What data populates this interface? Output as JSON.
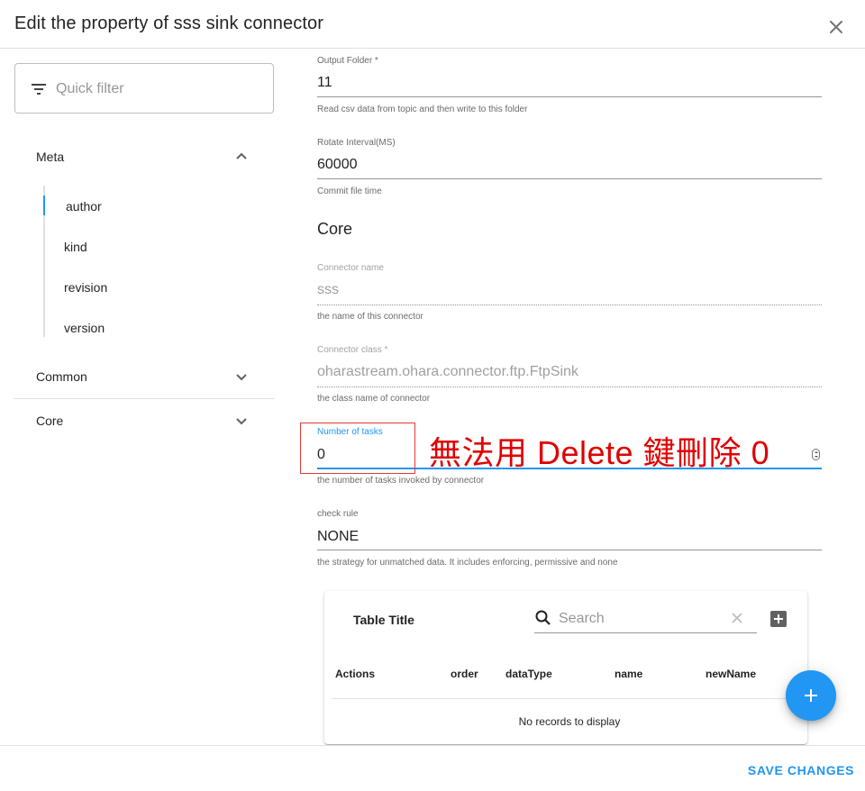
{
  "dialog": {
    "title": "Edit the property of sss sink connector",
    "close_icon": "close-icon"
  },
  "sidebar": {
    "filter_placeholder": "Quick filter",
    "filter_icon": "filter-list-icon",
    "sections": [
      {
        "label": "Meta",
        "expanded": true,
        "icon": "chevron-up-icon"
      },
      {
        "label": "Common",
        "expanded": false,
        "icon": "chevron-down-icon"
      },
      {
        "label": "Core",
        "expanded": false,
        "icon": "chevron-down-icon"
      }
    ],
    "meta_items": [
      {
        "label": "author",
        "active": true
      },
      {
        "label": "kind"
      },
      {
        "label": "revision"
      },
      {
        "label": "version"
      }
    ],
    "accent_color": "#2196f3"
  },
  "form": {
    "output_folder": {
      "label": "Output Folder *",
      "value": "11",
      "help": "Read csv data from topic and then write to this folder"
    },
    "rotate_interval": {
      "label": "Rotate Interval(MS)",
      "value": "60000",
      "help": "Commit file time"
    },
    "core_heading": "Core",
    "connector_name": {
      "label": "Connector name",
      "value": "sss",
      "help": "the name of this connector",
      "disabled": true
    },
    "connector_class": {
      "label": "Connector class *",
      "value": "oharastream.ohara.connector.ftp.FtpSink",
      "help": "the class name of connector",
      "disabled": true
    },
    "number_of_tasks": {
      "label": "Number of tasks",
      "value": "0",
      "help": "the number of tasks invoked by connector",
      "focused": true
    },
    "check_rule": {
      "label": "check rule",
      "value": "NONE",
      "help": "the strategy for unmatched data. It includes enforcing, permissive and none"
    }
  },
  "annotation": {
    "text": "無法用 Delete 鍵刪除 0",
    "color": "#e00000"
  },
  "table": {
    "title": "Table Title",
    "search_placeholder": "Search",
    "search_icon": "search-icon",
    "clear_icon": "clear-icon",
    "add_icon": "add-box-icon",
    "columns": [
      "Actions",
      "order",
      "dataType",
      "name",
      "newName"
    ],
    "empty_message": "No records to display"
  },
  "fab": {
    "icon": "add-icon",
    "color": "#2196f3"
  },
  "footer": {
    "save_label": "SAVE CHANGES"
  }
}
